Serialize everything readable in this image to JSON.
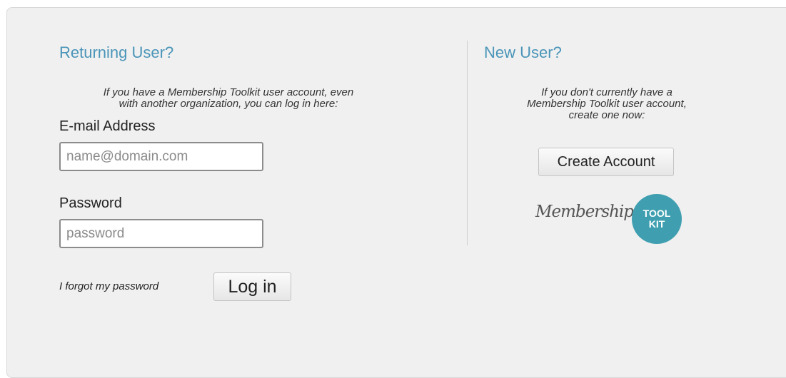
{
  "returning": {
    "heading": "Returning User?",
    "intro_line1": "If you have a Membership Toolkit user account, even",
    "intro_line2": "with another organization, you can log in here:",
    "email_label": "E-mail Address",
    "email_placeholder": "name@domain.com",
    "email_value": "",
    "password_label": "Password",
    "password_placeholder": "password",
    "password_value": "",
    "forgot_link": "I forgot my password",
    "login_button": "Log in"
  },
  "new_user": {
    "heading": "New User?",
    "intro_line1": "If you don't currently have a",
    "intro_line2": "Membership Toolkit user account,",
    "intro_line3": "create one now:",
    "create_button": "Create Account"
  },
  "logo": {
    "script_text": "Membership",
    "badge_line1": "TOOL",
    "badge_line2": "KIT",
    "badge_color": "#3f9fb0"
  },
  "colors": {
    "heading": "#4a95b8",
    "panel_background": "#f0f0f0"
  }
}
